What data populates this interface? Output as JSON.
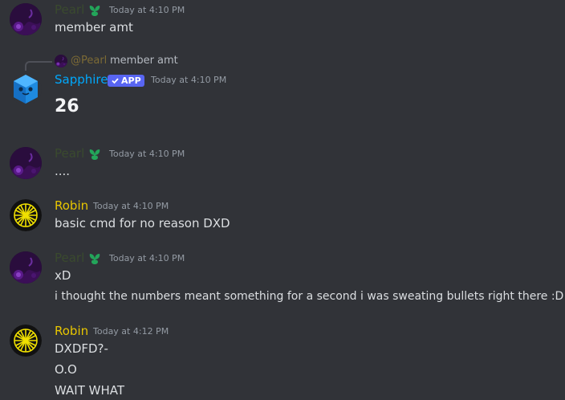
{
  "colors": {
    "background": "#313338",
    "pearl": "#3a4a2e",
    "sapphire": "#00a8fc",
    "robin": "#e8c600",
    "badge": "#5865f2",
    "timestamp": "#949ba4"
  },
  "messages": [
    {
      "author": "Pearl",
      "role_icon": "plant-icon",
      "timestamp": "Today at 4:10 PM",
      "lines": [
        "member amt"
      ]
    },
    {
      "reply": {
        "mention": "@Pearl",
        "text": "member amt"
      },
      "author": "Sapphire",
      "badge": "APP",
      "timestamp": "Today at 4:10 PM",
      "lines": [
        "26"
      ]
    },
    {
      "author": "Pearl",
      "role_icon": "plant-icon",
      "timestamp": "Today at 4:10 PM",
      "lines": [
        "...."
      ]
    },
    {
      "author": "Robin",
      "timestamp": "Today at 4:10 PM",
      "lines": [
        "basic cmd for no reason DXD"
      ]
    },
    {
      "author": "Pearl",
      "role_icon": "plant-icon",
      "timestamp": "Today at 4:10 PM",
      "lines": [
        "xD",
        "i thought the numbers meant something for a second i was sweating bullets right there :D"
      ]
    },
    {
      "author": "Robin",
      "timestamp": "Today at 4:12 PM",
      "lines": [
        "DXDFD?-",
        "O.O",
        "WAIT WHAT"
      ]
    }
  ]
}
